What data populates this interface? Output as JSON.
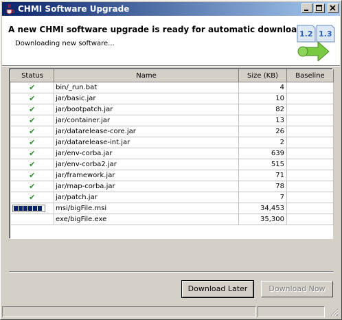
{
  "window": {
    "title": "CHMI Software Upgrade"
  },
  "header": {
    "headline": "A new CHMI software upgrade is ready for automatic download.",
    "status": "Downloading new software...",
    "version_from": "1.2",
    "version_to": "1.3"
  },
  "table": {
    "columns": [
      "Status",
      "Name",
      "Size (KB)",
      "Baseline"
    ],
    "rows": [
      {
        "status": "done",
        "name": "bin/_run.bat",
        "size": "4",
        "baseline": ""
      },
      {
        "status": "done",
        "name": "jar/basic.jar",
        "size": "10",
        "baseline": ""
      },
      {
        "status": "done",
        "name": "jar/bootpatch.jar",
        "size": "82",
        "baseline": ""
      },
      {
        "status": "done",
        "name": "jar/container.jar",
        "size": "13",
        "baseline": ""
      },
      {
        "status": "done",
        "name": "jar/datarelease-core.jar",
        "size": "26",
        "baseline": ""
      },
      {
        "status": "done",
        "name": "jar/datarelease-int.jar",
        "size": "2",
        "baseline": ""
      },
      {
        "status": "done",
        "name": "jar/env-corba.jar",
        "size": "639",
        "baseline": ""
      },
      {
        "status": "done",
        "name": "jar/env-corba2.jar",
        "size": "515",
        "baseline": ""
      },
      {
        "status": "done",
        "name": "jar/framework.jar",
        "size": "71",
        "baseline": ""
      },
      {
        "status": "done",
        "name": "jar/map-corba.jar",
        "size": "78",
        "baseline": ""
      },
      {
        "status": "done",
        "name": "jar/patch.jar",
        "size": "7",
        "baseline": ""
      },
      {
        "status": "downloading",
        "progress_segments": 6,
        "name": "msi/bigFile.msi",
        "size": "34,453",
        "baseline": ""
      },
      {
        "status": "pending",
        "name": "exe/bigFile.exe",
        "size": "35,300",
        "baseline": ""
      }
    ]
  },
  "buttons": {
    "download_later": "Download Later",
    "download_now": "Download Now"
  },
  "colors": {
    "check": "#2e8b2e",
    "progress": "#0a246a",
    "titlebar": "#0a246a"
  }
}
